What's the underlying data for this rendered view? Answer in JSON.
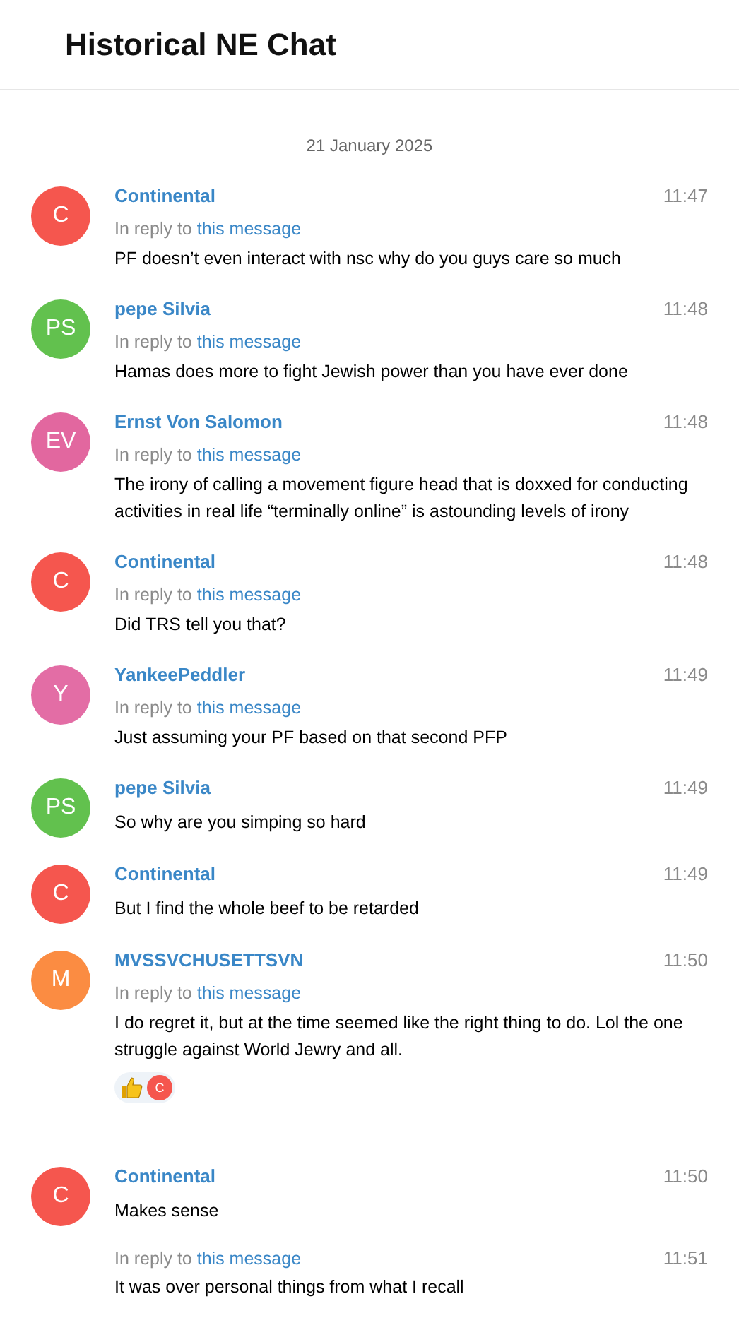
{
  "header": {
    "title": "Historical NE Chat"
  },
  "date": "21 January 2025",
  "messages": [
    {
      "kind": "full",
      "avatar": {
        "initials": "C",
        "color": "#f5564e"
      },
      "name": "Continental",
      "time": "11:47",
      "reply": {
        "prefix": "In reply to",
        "link": "this message"
      },
      "text": "PF doesn’t even interact with nsc why do you guys care so much"
    },
    {
      "kind": "full",
      "avatar": {
        "initials": "PS",
        "color": "#62c14e"
      },
      "name": "pepe Silvia",
      "time": "11:48",
      "reply": {
        "prefix": "In reply to",
        "link": "this message"
      },
      "text": "Hamas does more to fight Jewish power than you have ever done"
    },
    {
      "kind": "full",
      "avatar": {
        "initials": "EV",
        "color": "#e2679f"
      },
      "name": "Ernst Von Salomon",
      "time": "11:48",
      "reply": {
        "prefix": "In reply to",
        "link": "this message"
      },
      "text": "The irony of calling a movement figure head that is doxxed for conducting activities in real life “terminally online” is astounding levels of irony"
    },
    {
      "kind": "full",
      "avatar": {
        "initials": "C",
        "color": "#f5564e"
      },
      "name": "Continental",
      "time": "11:48",
      "reply": {
        "prefix": "In reply to",
        "link": "this message"
      },
      "text": "Did TRS tell you that?"
    },
    {
      "kind": "full",
      "avatar": {
        "initials": "Y",
        "color": "#e36da5"
      },
      "name": "YankeePeddler",
      "time": "11:49",
      "reply": {
        "prefix": "In reply to",
        "link": "this message"
      },
      "text": "Just assuming your PF based on that second PFP"
    },
    {
      "kind": "full",
      "avatar": {
        "initials": "PS",
        "color": "#62c14e"
      },
      "name": "pepe Silvia",
      "time": "11:49",
      "text": "So why are you simping so hard"
    },
    {
      "kind": "full",
      "avatar": {
        "initials": "C",
        "color": "#f5564e"
      },
      "name": "Continental",
      "time": "11:49",
      "text": "But I find the whole beef to be retarded"
    },
    {
      "kind": "full",
      "avatar": {
        "initials": "M",
        "color": "#fb8c42"
      },
      "name": "MVSSVCHUSETTSVN",
      "time": "11:50",
      "reply": {
        "prefix": "In reply to",
        "link": "this message"
      },
      "text": "I do regret it, but at the time seemed like the right thing to do. Lol the one struggle against World Jewry and all.",
      "reactions": [
        {
          "kind": "thumbs-up",
          "users": [
            {
              "initials": "C",
              "color": "#f5564e"
            }
          ]
        }
      ]
    },
    {
      "kind": "full",
      "avatar": {
        "initials": "C",
        "color": "#f5564e"
      },
      "name": "Continental",
      "time": "11:50",
      "text": "Makes sense"
    },
    {
      "kind": "continued",
      "time": "11:51",
      "reply": {
        "prefix": "In reply to",
        "link": "this message"
      },
      "text": "It was over personal things from what I recall"
    }
  ]
}
